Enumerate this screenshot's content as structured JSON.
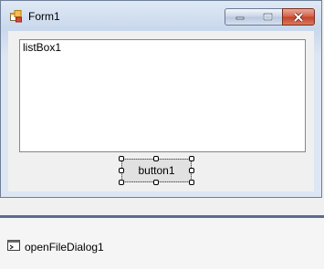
{
  "form": {
    "title": "Form1",
    "icon": "form-app-icon",
    "window_buttons": [
      "minimize-icon",
      "maximize-icon",
      "close-icon"
    ]
  },
  "listbox": {
    "label": "listBox1"
  },
  "button": {
    "label": "button1"
  },
  "tray": {
    "items": [
      {
        "label": "openFileDialog1",
        "icon": "dialog-component-icon"
      }
    ]
  },
  "colors": {
    "close_button": "#c84a30",
    "splitter": "#5c6a8e",
    "form_border": "#6f7f98"
  }
}
